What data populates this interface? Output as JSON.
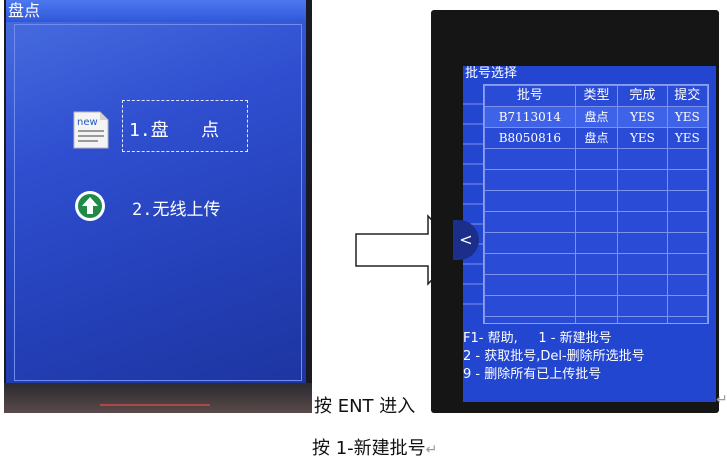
{
  "left_screen": {
    "title": "盘点",
    "menu_item_1": "1.盘   点",
    "menu_item_2": "2.无线上传",
    "doc_icon_label": "new"
  },
  "right_screen": {
    "title": "批号选择",
    "columns": [
      "批号",
      "类型",
      "完成",
      "提交"
    ],
    "rows": [
      [
        "B7113014",
        "盘点",
        "YES",
        "YES"
      ],
      [
        "B8050816",
        "盘点",
        "YES",
        "YES"
      ]
    ],
    "help_lines": [
      "F1- 帮助,     1 - 新建批号",
      "2 - 获取批号,Del-删除所选批号",
      "9 - 删除所有已上传批号"
    ],
    "nav_chevron": "<"
  },
  "captions": {
    "press_ent": "按 ENT 进入",
    "new_batch": "按 1-新建批号"
  },
  "icons": [
    "document-icon",
    "upload-arrow-icon",
    "right-arrow-icon",
    "paragraph-return-icon"
  ],
  "colors": {
    "screen_blue": "#2346d0",
    "left_screen_blue": "#2f4fd0"
  }
}
